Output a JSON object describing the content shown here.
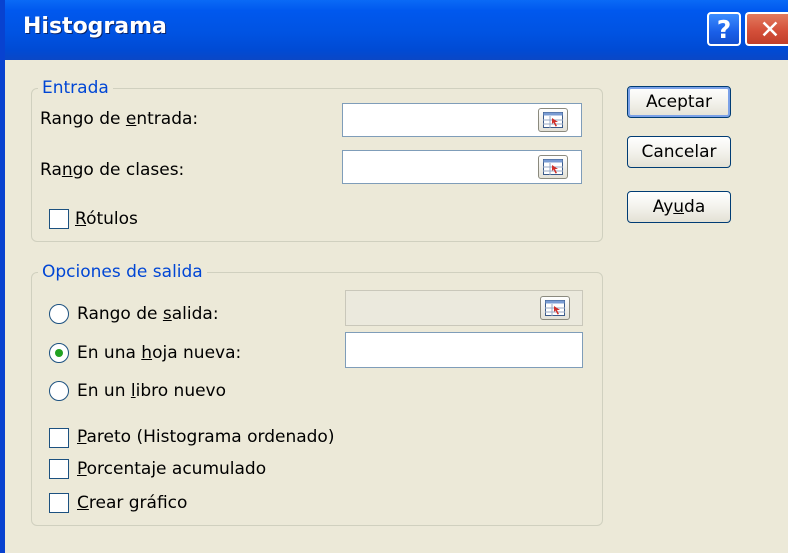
{
  "window": {
    "title": "Histograma",
    "help_glyph": "?",
    "close_glyph": "✕"
  },
  "input_group": {
    "legend": "Entrada",
    "input_range": {
      "label_pre": "Rango de ",
      "label_mnemonic": "e",
      "label_post": "ntrada:",
      "value": ""
    },
    "bin_range": {
      "label_pre": "Ra",
      "label_mnemonic": "n",
      "label_post": "go de clases:",
      "value": ""
    },
    "labels_checkbox": {
      "label_mnemonic": "R",
      "label_post": "ótulos",
      "checked": false
    }
  },
  "output_group": {
    "legend": "Opciones de salida",
    "output_range": {
      "label_pre": "Rango de ",
      "label_mnemonic": "s",
      "label_post": "alida:",
      "selected": false,
      "value": ""
    },
    "new_sheet": {
      "label_pre": "En una ",
      "label_mnemonic": "h",
      "label_post": "oja nueva:",
      "selected": true,
      "value": ""
    },
    "new_workbook": {
      "label_pre": "En un ",
      "label_mnemonic": "l",
      "label_post": "ibro nuevo",
      "selected": false
    },
    "pareto": {
      "label_mnemonic": "P",
      "label_post": "areto (Histograma ordenado)",
      "checked": false
    },
    "cumulative": {
      "label_mnemonic": "P",
      "label_post": "orcentaje acumulado",
      "checked": false
    },
    "chart": {
      "label_mnemonic": "C",
      "label_post": "rear gráfico",
      "checked": false
    }
  },
  "buttons": {
    "ok": "Aceptar",
    "cancel": "Cancelar",
    "help_pre": "Ay",
    "help_mnemonic": "u",
    "help_post": "da"
  },
  "icons": {
    "title_help": "question-mark-icon",
    "title_close": "close-icon",
    "range_picker": "collapse-dialog-icon"
  },
  "colors": {
    "title_bar": "#0058ee",
    "dialog_bg": "#ece9d8",
    "legend_text": "#0046d5",
    "close_button": "#d4503a",
    "radio_dot": "#21a121"
  }
}
